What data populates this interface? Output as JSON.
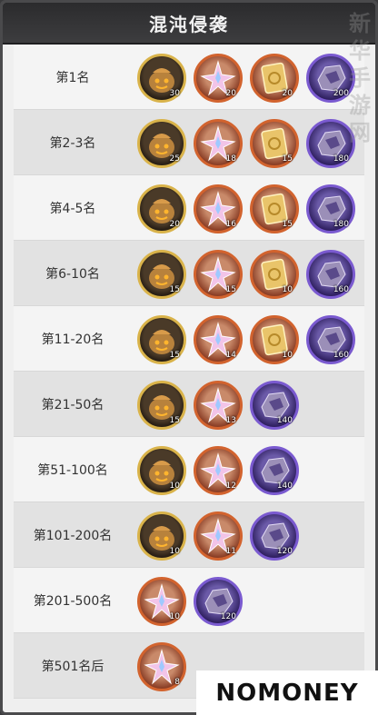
{
  "header": {
    "title": "混沌侵袭"
  },
  "rows": [
    {
      "rank": "第1名",
      "items": [
        {
          "kind": "gold",
          "icon": "pumpkin-bag-icon",
          "qty": "30"
        },
        {
          "kind": "orange",
          "icon": "crystal-star-icon",
          "qty": "20"
        },
        {
          "kind": "orange",
          "icon": "gold-card-icon",
          "qty": "20"
        },
        {
          "kind": "purple",
          "icon": "purple-ore-icon",
          "qty": "200"
        }
      ]
    },
    {
      "rank": "第2-3名",
      "items": [
        {
          "kind": "gold",
          "icon": "pumpkin-bag-icon",
          "qty": "25"
        },
        {
          "kind": "orange",
          "icon": "crystal-star-icon",
          "qty": "18"
        },
        {
          "kind": "orange",
          "icon": "gold-card-icon",
          "qty": "15"
        },
        {
          "kind": "purple",
          "icon": "purple-ore-icon",
          "qty": "180"
        }
      ]
    },
    {
      "rank": "第4-5名",
      "items": [
        {
          "kind": "gold",
          "icon": "pumpkin-bag-icon",
          "qty": "20"
        },
        {
          "kind": "orange",
          "icon": "crystal-star-icon",
          "qty": "16"
        },
        {
          "kind": "orange",
          "icon": "gold-card-icon",
          "qty": "15"
        },
        {
          "kind": "purple",
          "icon": "purple-ore-icon",
          "qty": "180"
        }
      ]
    },
    {
      "rank": "第6-10名",
      "items": [
        {
          "kind": "gold",
          "icon": "pumpkin-bag-icon",
          "qty": "15"
        },
        {
          "kind": "orange",
          "icon": "crystal-star-icon",
          "qty": "15"
        },
        {
          "kind": "orange",
          "icon": "gold-card-icon",
          "qty": "10"
        },
        {
          "kind": "purple",
          "icon": "purple-ore-icon",
          "qty": "160"
        }
      ]
    },
    {
      "rank": "第11-20名",
      "items": [
        {
          "kind": "gold",
          "icon": "pumpkin-bag-icon",
          "qty": "15"
        },
        {
          "kind": "orange",
          "icon": "crystal-star-icon",
          "qty": "14"
        },
        {
          "kind": "orange",
          "icon": "gold-card-icon",
          "qty": "10"
        },
        {
          "kind": "purple",
          "icon": "purple-ore-icon",
          "qty": "160"
        }
      ]
    },
    {
      "rank": "第21-50名",
      "items": [
        {
          "kind": "gold",
          "icon": "pumpkin-bag-icon",
          "qty": "15"
        },
        {
          "kind": "orange",
          "icon": "crystal-star-icon",
          "qty": "13"
        },
        {
          "kind": "purple",
          "icon": "purple-ore-icon",
          "qty": "140"
        }
      ]
    },
    {
      "rank": "第51-100名",
      "items": [
        {
          "kind": "gold",
          "icon": "pumpkin-bag-icon",
          "qty": "10"
        },
        {
          "kind": "orange",
          "icon": "crystal-star-icon",
          "qty": "12"
        },
        {
          "kind": "purple",
          "icon": "purple-ore-icon",
          "qty": "140"
        }
      ]
    },
    {
      "rank": "第101-200名",
      "items": [
        {
          "kind": "gold",
          "icon": "pumpkin-bag-icon",
          "qty": "10"
        },
        {
          "kind": "orange",
          "icon": "crystal-star-icon",
          "qty": "11"
        },
        {
          "kind": "purple",
          "icon": "purple-ore-icon",
          "qty": "120"
        }
      ]
    },
    {
      "rank": "第201-500名",
      "items": [
        {
          "kind": "orange",
          "icon": "crystal-star-icon",
          "qty": "10"
        },
        {
          "kind": "purple",
          "icon": "purple-ore-icon",
          "qty": "120"
        }
      ]
    },
    {
      "rank": "第501名后",
      "items": [
        {
          "kind": "orange",
          "icon": "crystal-star-icon",
          "qty": "8"
        }
      ]
    }
  ],
  "watermark": {
    "text": "新华手游网"
  },
  "logo": {
    "text": "NOMONEY"
  }
}
